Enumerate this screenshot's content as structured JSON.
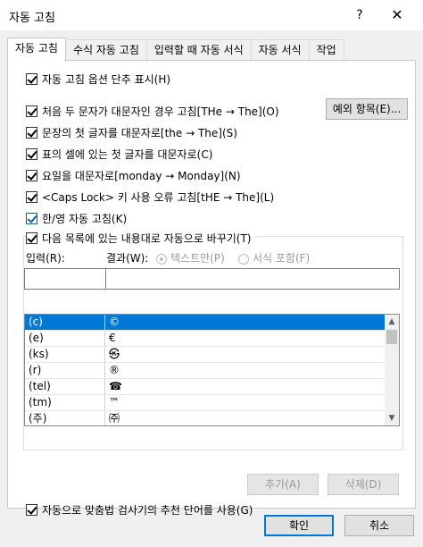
{
  "window": {
    "title": "자동 고침",
    "help": "?",
    "close": "✕"
  },
  "tabs": [
    {
      "label": "자동 고침",
      "active": true
    },
    {
      "label": "수식 자동 고침",
      "active": false
    },
    {
      "label": "입력할 때 자동 서식",
      "active": false
    },
    {
      "label": "자동 서식",
      "active": false
    },
    {
      "label": "작업",
      "active": false
    }
  ],
  "options": {
    "show_buttons": "자동 고침 옵션 단추 표시(H)",
    "two_initial_caps": "처음 두 문자가 대문자인 경우 고침[THe → The](O)",
    "capitalize_sentences": "문장의 첫 글자를 대문자로[the → The](S)",
    "capitalize_table_cells": "표의 셀에 있는 첫 글자를 대문자로(C)",
    "capitalize_days": "요일을 대문자로[monday → Monday](N)",
    "caps_lock": "<Caps Lock> 키 사용 오류 고침[tHE → The](L)",
    "korean_english": "한/영 자동 고침(K)",
    "replace_text": "다음 목록에 있는 내용대로 자동으로 바꾸기(T)",
    "use_spellchecker": "자동으로 맞춤법 검사기의 추천 단어를 사용(G)"
  },
  "exceptions_button": "예외 항목(E)...",
  "replace": {
    "input_label": "입력(R):",
    "result_label": "결과(W):",
    "radio_plain": "텍스트만(P)",
    "radio_formatted": "서식 포함(F)",
    "input_value": "",
    "result_value": ""
  },
  "list_items": [
    {
      "key": "(c)",
      "value": "©"
    },
    {
      "key": "(e)",
      "value": "€"
    },
    {
      "key": "(ks)",
      "value": "㉿"
    },
    {
      "key": "(r)",
      "value": "®"
    },
    {
      "key": "(tel)",
      "value": "☎"
    },
    {
      "key": "(tm)",
      "value": "™"
    },
    {
      "key": "(주)",
      "value": "㈜"
    }
  ],
  "buttons": {
    "add": "추가(A)",
    "delete": "삭제(D)",
    "ok": "확인",
    "cancel": "취소"
  },
  "colors": {
    "accent": "#0078d7",
    "selected_row": "#0078d7"
  }
}
